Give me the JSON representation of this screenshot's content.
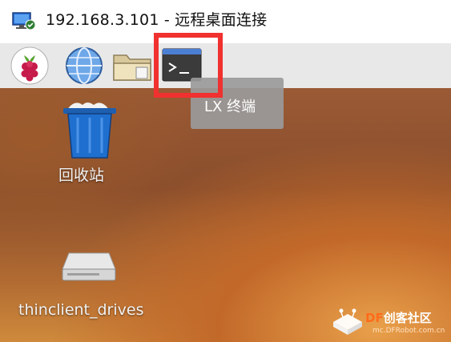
{
  "window": {
    "title": "192.168.3.101 - 远程桌面连接",
    "icon": "remote-desktop-icon"
  },
  "panel": {
    "buttons": [
      {
        "icon": "raspberry-menu-icon"
      },
      {
        "icon": "web-browser-globe-icon"
      },
      {
        "icon": "file-manager-folder-icon"
      },
      {
        "icon": "terminal-icon"
      }
    ]
  },
  "tooltip": {
    "text": "LX 终端"
  },
  "desktop": {
    "icons": [
      {
        "label": "回收站",
        "icon": "trash-icon"
      },
      {
        "label": "thinclient_drives",
        "icon": "drive-icon"
      }
    ]
  },
  "watermark": {
    "brand_df": "DF",
    "brand_rest": "创客社区",
    "url": "mc.DFRobot.com.cn"
  },
  "colors": {
    "highlight": "#f0312f",
    "panel": "#e8e8e8",
    "tooltip": "#9a9a9a",
    "brand_orange": "#ff6b1a"
  }
}
